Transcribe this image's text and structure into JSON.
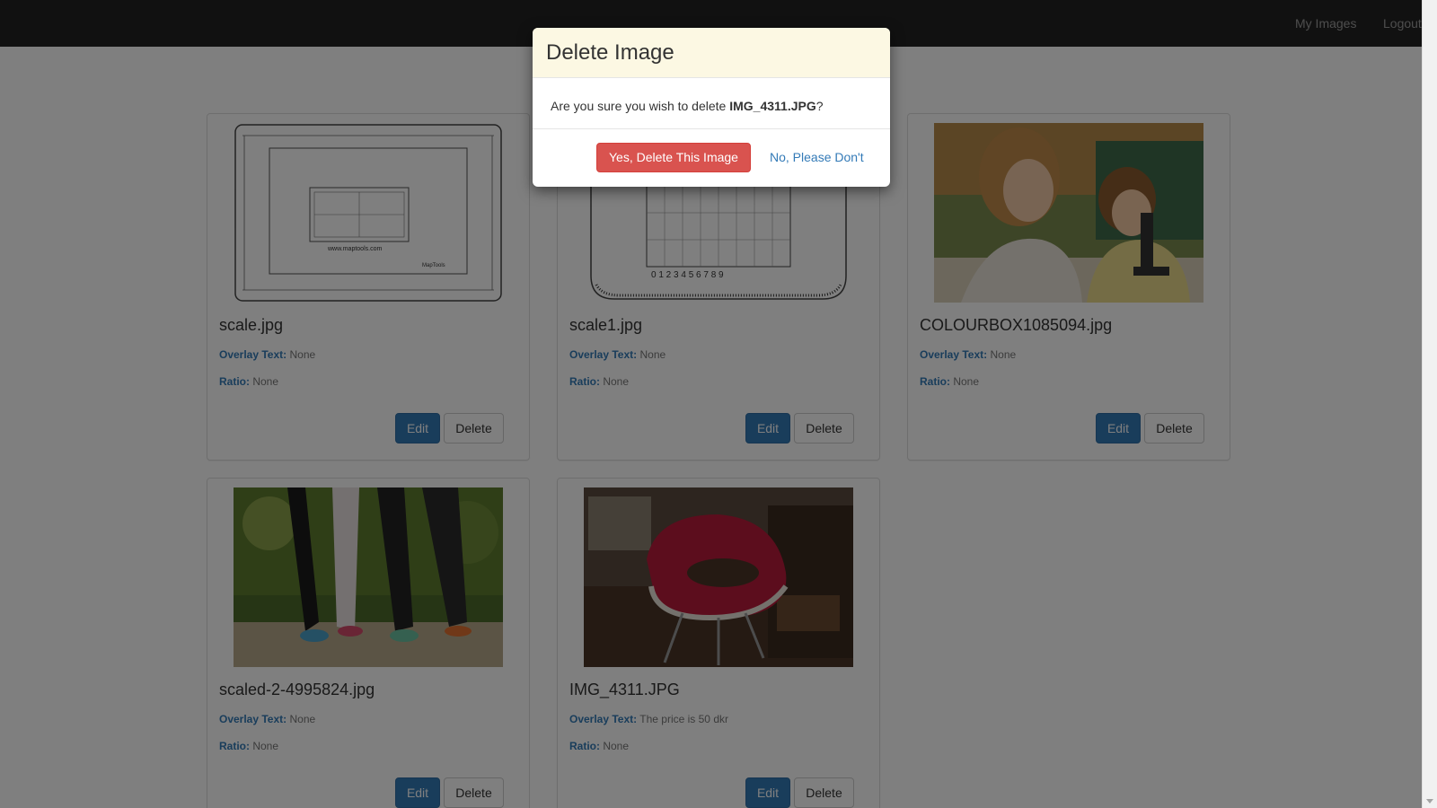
{
  "nav": {
    "my_images": "My Images",
    "logout": "Logout"
  },
  "cards": [
    {
      "title": "scale.jpg",
      "overlay_label": "Overlay Text:",
      "overlay_value": "None",
      "ratio_label": "Ratio:",
      "ratio_value": "None",
      "edit_label": "Edit",
      "delete_label": "Delete"
    },
    {
      "title": "scale1.jpg",
      "overlay_label": "Overlay Text:",
      "overlay_value": "None",
      "ratio_label": "Ratio:",
      "ratio_value": "None",
      "edit_label": "Edit",
      "delete_label": "Delete"
    },
    {
      "title": "COLOURBOX1085094.jpg",
      "overlay_label": "Overlay Text:",
      "overlay_value": "None",
      "ratio_label": "Ratio:",
      "ratio_value": "None",
      "edit_label": "Edit",
      "delete_label": "Delete"
    },
    {
      "title": "scaled-2-4995824.jpg",
      "overlay_label": "Overlay Text:",
      "overlay_value": "None",
      "ratio_label": "Ratio:",
      "ratio_value": "None",
      "edit_label": "Edit",
      "delete_label": "Delete"
    },
    {
      "title": "IMG_4311.JPG",
      "overlay_label": "Overlay Text:",
      "overlay_value": "The price is 50 dkr",
      "ratio_label": "Ratio:",
      "ratio_value": "None",
      "edit_label": "Edit",
      "delete_label": "Delete"
    }
  ],
  "modal": {
    "title": "Delete Image",
    "body_prefix": "Are you sure you wish to delete ",
    "filename": "IMG_4311.JPG",
    "body_suffix": "?",
    "confirm_label": "Yes, Delete This Image",
    "cancel_label": "No, Please Don't"
  },
  "colors": {
    "navbar": "#222222",
    "link": "#337ab7",
    "danger": "#d9534f",
    "modal_header": "#fcf8e3"
  }
}
